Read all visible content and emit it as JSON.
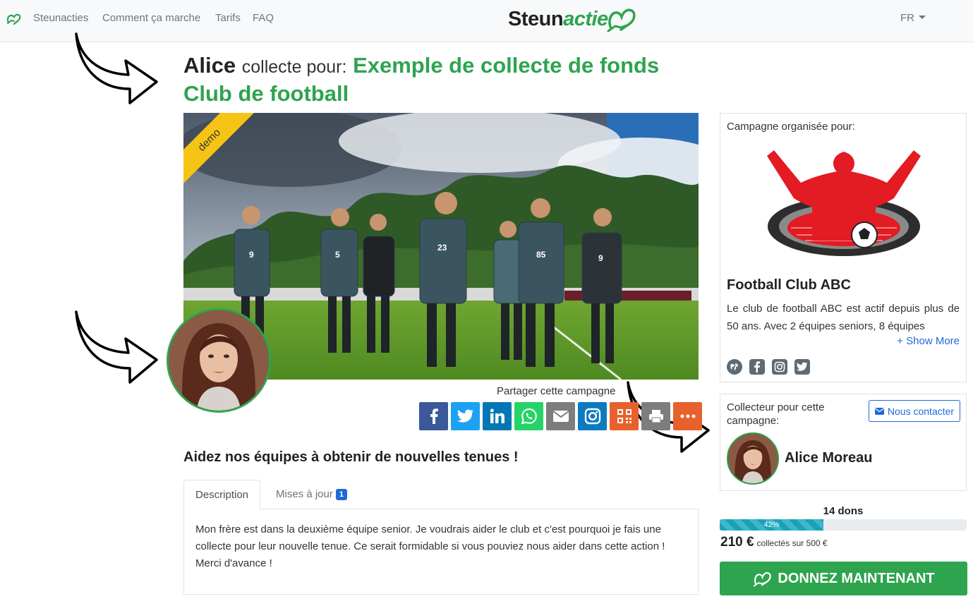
{
  "nav": {
    "links": [
      "Steunacties",
      "Comment ça marche",
      "Tarifs",
      "FAQ"
    ],
    "brand_part1": "Steun",
    "brand_part2": "actie",
    "language": "FR",
    "logo_icon": "heart-hand-icon"
  },
  "campaign": {
    "organizer_first_name": "Alice",
    "collects_for": "collecte pour:",
    "title": "Exemple de collecte de fonds Club de football",
    "ribbon": "demo",
    "headline": "Aidez nos équipes à obtenir de nouvelles tenues !",
    "share_label": "Partager cette campagne",
    "share_buttons": [
      {
        "icon": "facebook-icon",
        "color": "#3b5998"
      },
      {
        "icon": "twitter-icon",
        "color": "#1da1f2"
      },
      {
        "icon": "linkedin-icon",
        "color": "#0077b5"
      },
      {
        "icon": "whatsapp-icon",
        "color": "#25d366"
      },
      {
        "icon": "email-icon",
        "color": "#7d7d7d"
      },
      {
        "icon": "instagram-icon",
        "color": "#0a7bc1"
      },
      {
        "icon": "qr-code-icon",
        "color": "#e8612c"
      },
      {
        "icon": "print-icon",
        "color": "#7d7d7d"
      },
      {
        "icon": "more-icon",
        "color": "#e8612c"
      }
    ]
  },
  "tabs": {
    "description": "Description",
    "updates": "Mises à jour",
    "updates_count": "1",
    "description_text": "Mon frère est dans la deuxième équipe senior. Je voudrais aider le club et c'est pourquoi je fais une collecte pour leur nouvelle tenue. Ce serait formidable si vous pouviez nous aider dans cette action ! Merci d'avance !"
  },
  "organization": {
    "label": "Campagne organisée pour:",
    "name": "Football Club ABC",
    "description": "Le club de football ABC est actif depuis plus de 50 ans. Avec 2 équipes seniors, 8 équipes",
    "show_more": "+ Show More",
    "socials": [
      "globe-icon",
      "facebook-icon",
      "instagram-icon",
      "twitter-icon"
    ]
  },
  "collector": {
    "label": "Collecteur pour cette campagne:",
    "contact_button": "Nous contacter",
    "name": "Alice Moreau"
  },
  "stats": {
    "donations": "14 dons",
    "progress_percent": 42,
    "progress_label": "42%",
    "raised": "210 €",
    "raised_suffix": "collectés sur 500 €",
    "donate_button": "DONNEZ MAINTENANT"
  },
  "colors": {
    "brand_green": "#2ea44f",
    "link_blue": "#1f6ad8",
    "progress": "#17a2b8",
    "ribbon": "#f6c414"
  }
}
